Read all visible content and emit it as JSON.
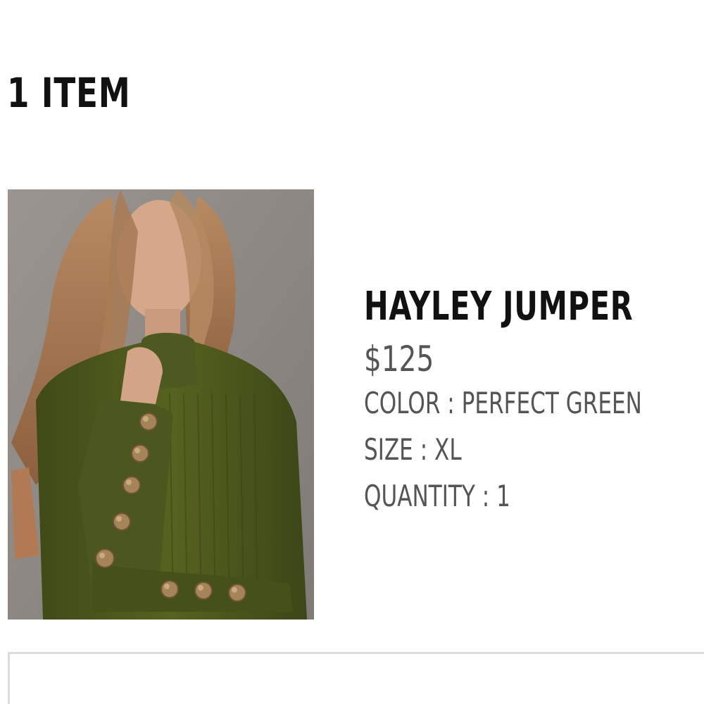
{
  "cart": {
    "item_count_label": "1 ITEM"
  },
  "product": {
    "name": "HAYLEY JUMPER",
    "price": "$125",
    "color_label": "COLOR : PERFECT GREEN",
    "size_label": "SIZE : XL",
    "quantity_label": "QUANTITY : 1",
    "image_icon": "product-photo"
  },
  "colors": {
    "heading_text": "#111111",
    "detail_text": "#555555",
    "jumper_green": "#4f5a22",
    "button_gold": "#a6845a",
    "panel_border": "#dcdcdc"
  }
}
